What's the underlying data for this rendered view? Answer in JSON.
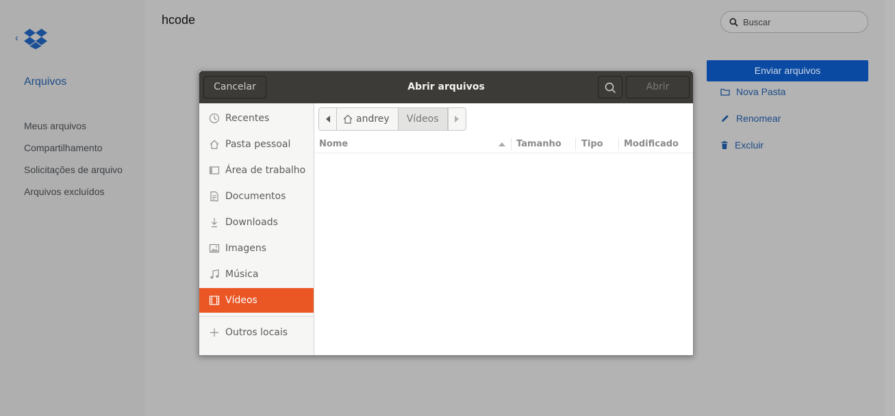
{
  "app": {
    "title": "hcode",
    "sidebar": {
      "heading": "Arquivos",
      "links": [
        "Meus arquivos",
        "Compartilhamento",
        "Solicitações de arquivo",
        "Arquivos excluídos"
      ]
    },
    "search": {
      "placeholder": "Buscar"
    },
    "actions": {
      "upload": "Enviar arquivos",
      "new_folder": "Nova Pasta",
      "rename": "Renomear",
      "delete": "Excluir"
    }
  },
  "dialog": {
    "title": "Abrir arquivos",
    "cancel": "Cancelar",
    "open": "Abrir",
    "places": [
      {
        "label": "Recentes",
        "icon": "clock-icon"
      },
      {
        "label": "Pasta pessoal",
        "icon": "home-icon"
      },
      {
        "label": "Área de trabalho",
        "icon": "desktop-icon"
      },
      {
        "label": "Documentos",
        "icon": "document-icon"
      },
      {
        "label": "Downloads",
        "icon": "download-icon"
      },
      {
        "label": "Imagens",
        "icon": "image-icon"
      },
      {
        "label": "Música",
        "icon": "music-icon"
      },
      {
        "label": "Vídeos",
        "icon": "video-icon",
        "active": true
      }
    ],
    "other_locations": "Outros locais",
    "path": [
      "andrey",
      "Vídeos"
    ],
    "columns": [
      "Nome",
      "Tamanho",
      "Tipo",
      "Modificado"
    ]
  },
  "colors": {
    "accent": "#ea5725",
    "headerbar": "#3d3b38",
    "brand_blue": "#0b4aa3"
  }
}
